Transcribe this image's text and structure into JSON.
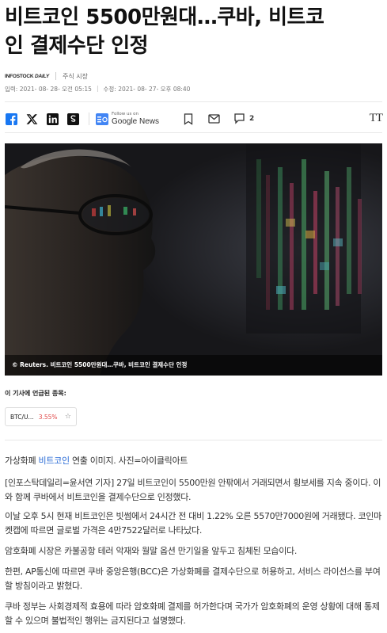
{
  "article": {
    "title_line1": "비트코인 5500만원대…쿠바, 비트코",
    "title_line2": "인 결제수단 인정",
    "source_logo_line1": "INFOSTOCK",
    "source_logo_line2": "DAILY",
    "category": "주식 시장",
    "published": "입력: 2021- 08- 28- 오전 05:15",
    "modified": "수정: 2021- 08- 27- 오후 08:40"
  },
  "share": {
    "icons": [
      "facebook-icon",
      "x-icon",
      "linkedin-icon",
      "share-s-icon"
    ],
    "google_news_small": "Follow us on",
    "google_news_big": "Google News",
    "comment_count": "2",
    "text_size_label": "TT"
  },
  "photo": {
    "caption": "© Reuters. 비트코인 5500만원대…쿠바, 비트코인 결제수단 인정"
  },
  "mentions": {
    "label": "이 기사에 언급된 종목:",
    "tickers": [
      {
        "name": "BTC/U...",
        "change": "3.55%"
      }
    ]
  },
  "body": {
    "p1_pre": "가상화폐 ",
    "p1_link": "비트코인",
    "p1_post": " 연출 이미지. 사진=아이클릭아트",
    "p2": "[인포스탁데일리=윤서연 기자] 27일 비트코인이 5500만원 안팎에서 거래되면서 횡보세를 지속 중이다. 이와 함께 쿠바에서 비트코인을 결제수단으로 인정했다.",
    "p3": "이날 오후 5시 현재 비트코인은 빗썸에서 24시간 전 대비 1.22% 오른 5570만7000원에 거래됐다. 코인마켓캡에 따르면 글로벌 가격은 4만7522달러로 나타났다.",
    "p4": "암호화폐 시장은 카불공항 테러 악재와 월말 옵션 만기일을 앞두고 침체된 모습이다.",
    "p5": "한편, AP통신에 따르면 쿠바 중앙은행(BCC)은 가상화폐를 결제수단으로 허용하고, 서비스 라이선스를 부여할 방침이라고 밝혔다.",
    "p6": "쿠바 정부는 사회경제적 효용에 따라 암호화폐 결제를 허가한다며 국가가 암호화폐의 운영 상황에 대해 통제할 수 있으며 불법적인 행위는 금지된다고 설명했다."
  },
  "colors": {
    "link": "#2a6bd6",
    "negative_change": "#e04848"
  }
}
